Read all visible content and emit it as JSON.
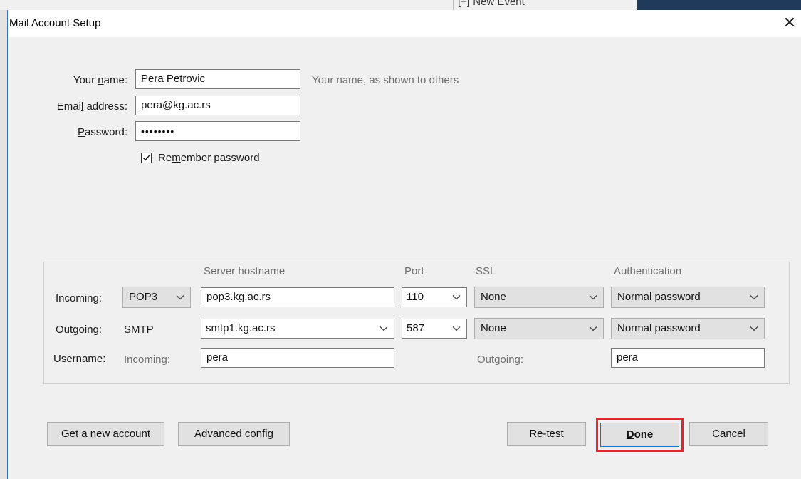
{
  "background": {
    "event_label": "[+] New Event"
  },
  "dialog": {
    "title": "Mail Account Setup",
    "close_label": "✕"
  },
  "identity": {
    "name_label_pre": "Your ",
    "name_label_key": "n",
    "name_label_post": "ame:",
    "name_value": "Pera Petrovic",
    "name_hint": "Your name, as shown to others",
    "email_label_pre": "Emai",
    "email_label_key": "l",
    "email_label_post": " address:",
    "email_value": "pera@kg.ac.rs",
    "password_label_key": "P",
    "password_label_post": "assword:",
    "password_value": "••••••••",
    "remember_pre": "Re",
    "remember_key": "m",
    "remember_post": "ember password",
    "remember_checked": true
  },
  "server": {
    "headers": {
      "hostname": "Server hostname",
      "port": "Port",
      "ssl": "SSL",
      "auth": "Authentication"
    },
    "incoming": {
      "label": "Incoming:",
      "protocol": "POP3",
      "hostname": "pop3.kg.ac.rs",
      "port": "110",
      "ssl": "None",
      "auth": "Normal password"
    },
    "outgoing": {
      "label": "Outgoing:",
      "protocol": "SMTP",
      "hostname": "smtp1.kg.ac.rs",
      "port": "587",
      "ssl": "None",
      "auth": "Normal password"
    },
    "username": {
      "label": "Username:",
      "incoming_label": "Incoming:",
      "incoming_value": "pera",
      "outgoing_label": "Outgoing:",
      "outgoing_value": "pera"
    }
  },
  "buttons": {
    "new_account_key": "G",
    "new_account_post": "et a new account",
    "advanced_key": "A",
    "advanced_post": "dvanced config",
    "retest_pre": "Re-",
    "retest_key": "t",
    "retest_post": "est",
    "done_key": "D",
    "done_post": "one",
    "cancel_pre": "C",
    "cancel_key": "a",
    "cancel_post": "ncel"
  },
  "colors": {
    "dialog_bg": "#f0f0f0",
    "highlight_border": "#e0262f",
    "default_button_border": "#0078d7"
  }
}
